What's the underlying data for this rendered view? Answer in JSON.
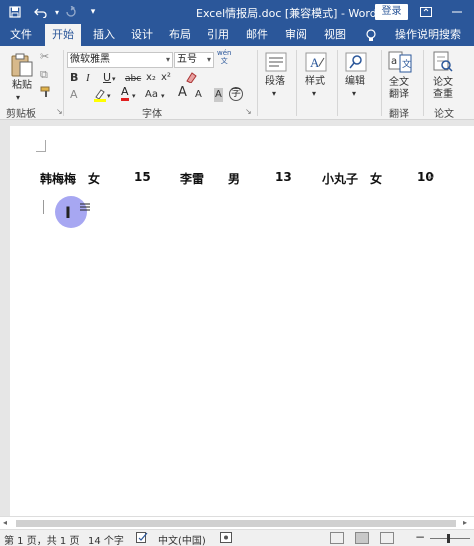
{
  "titlebar": {
    "title": "Excel情报局.doc [兼容模式] - Word",
    "login_label": "登录",
    "save_icon": "save-icon",
    "undo_icon": "undo-icon",
    "redo_icon": "redo-icon"
  },
  "tabs": [
    {
      "label": "文件"
    },
    {
      "label": "开始"
    },
    {
      "label": "插入"
    },
    {
      "label": "设计"
    },
    {
      "label": "布局"
    },
    {
      "label": "引用"
    },
    {
      "label": "邮件"
    },
    {
      "label": "审阅"
    },
    {
      "label": "视图"
    }
  ],
  "tell_me": "操作说明搜索",
  "ribbon": {
    "paste_label": "粘贴",
    "clipboard_label": "剪贴板",
    "font_name": "微软雅黑",
    "font_size": "五号",
    "font_group_label": "字体",
    "wen_label": "wén\n文",
    "bold": "B",
    "italic": "I",
    "underline": "U",
    "strike": "abc",
    "subscript": "x₂",
    "superscript": "x²",
    "clear_format": "A",
    "font_color": "A",
    "highlight": "A",
    "aa_case": "Aa",
    "grow_font": "A",
    "shrink_font": "A",
    "char_border": "A",
    "char_shade": "A",
    "circle_char": "字",
    "paragraph_label": "段落",
    "styles_label": "样式",
    "editing_label": "编辑",
    "translate_btn_line1": "全文",
    "translate_btn_line2": "翻译",
    "translate_group_label": "翻译",
    "paper_btn_line1": "论文",
    "paper_btn_line2": "查重",
    "paper_group_label": "论文"
  },
  "document": {
    "cells": [
      "韩梅梅",
      "女",
      "15",
      "李雷",
      "男",
      "13",
      "小丸子",
      "女",
      "10"
    ]
  },
  "statusbar": {
    "page": "第 1 页，共 1 页",
    "words": "14 个字",
    "language": "中文(中国)"
  },
  "colors": {
    "brand": "#2b579a",
    "ribbon_bg": "#f3f3f3",
    "cursor_highlight": "#8080eb"
  }
}
